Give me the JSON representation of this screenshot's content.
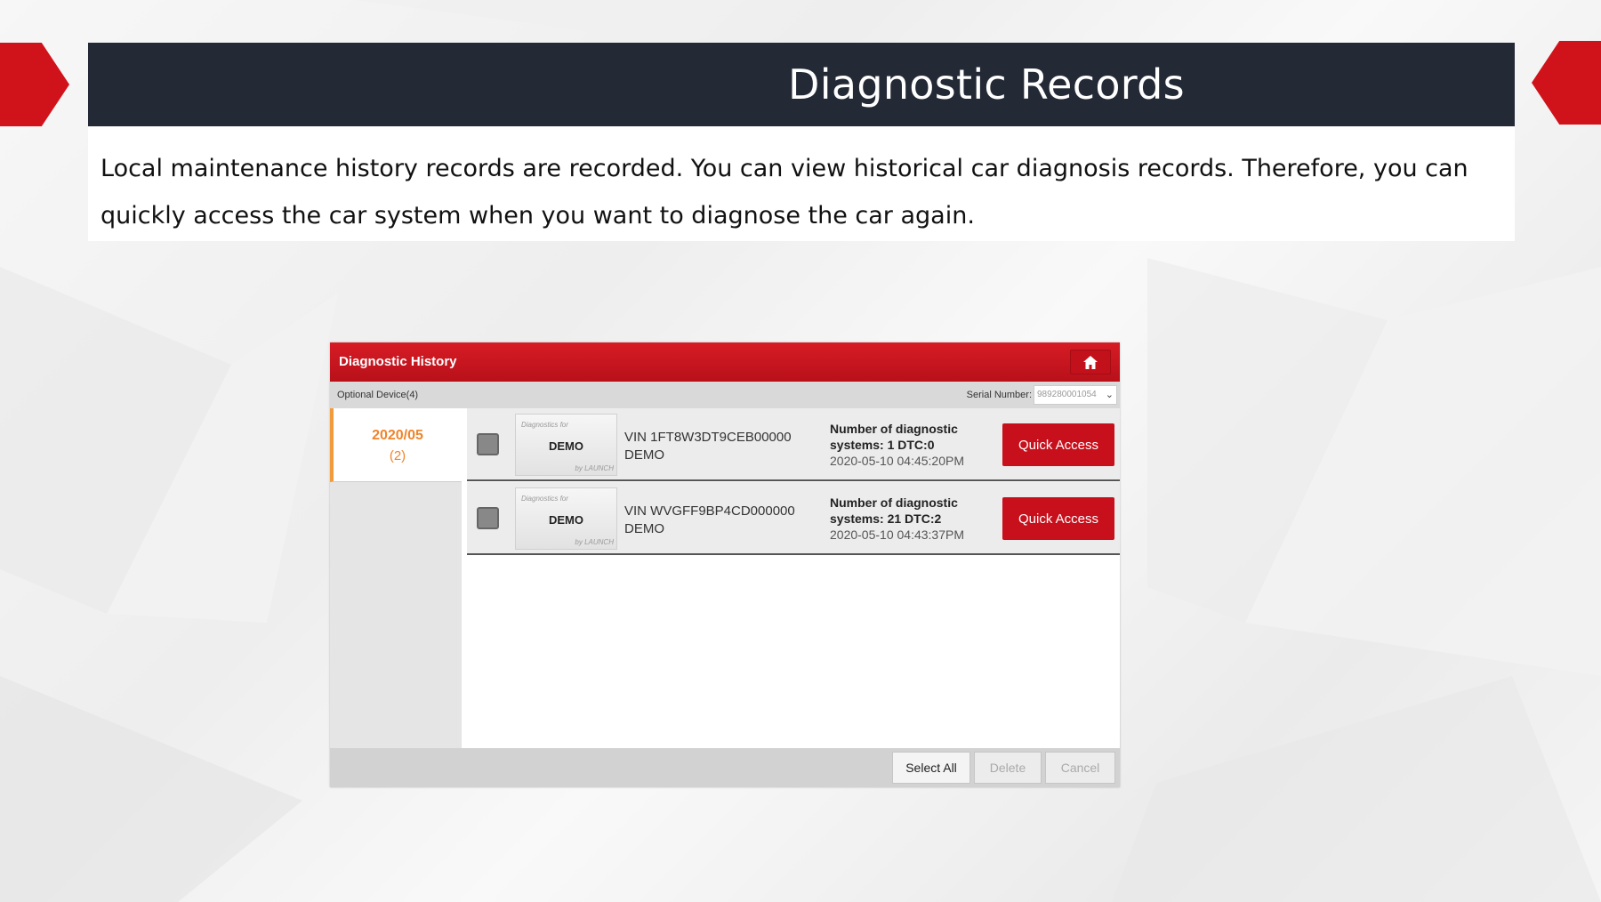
{
  "slide": {
    "title": "Diagnostic Records",
    "description": "Local maintenance history records are recorded. You can view historical car diagnosis records. Therefore, you can quickly access the car system when you want to diagnose the car again.",
    "accent_color": "#d0121b",
    "title_bar_color": "#232a36"
  },
  "app": {
    "header_title": "Diagnostic History",
    "home_icon": "home-icon",
    "optional_device_label": "Optional Device(4)",
    "serial_label": "Serial Number:",
    "serial_value": "989280001054",
    "date_group": {
      "date": "2020/05",
      "count": "(2)"
    },
    "records": [
      {
        "thumb_top": "Diagnostics for",
        "thumb_main": "DEMO",
        "thumb_bottom": "by LAUNCH",
        "vin": "VIN 1FT8W3DT9CEB00000",
        "model": "DEMO",
        "info_line1": "Number of diagnostic",
        "info_line2": "systems: 1 DTC:0",
        "timestamp": "2020-05-10 04:45:20PM",
        "button": "Quick Access"
      },
      {
        "thumb_top": "Diagnostics for",
        "thumb_main": "DEMO",
        "thumb_bottom": "by LAUNCH",
        "vin": "VIN WVGFF9BP4CD000000",
        "model": "DEMO",
        "info_line1": "Number of diagnostic",
        "info_line2": "systems: 21 DTC:2",
        "timestamp": "2020-05-10 04:43:37PM",
        "button": "Quick Access"
      }
    ],
    "footer": {
      "select_all": "Select All",
      "delete": "Delete",
      "cancel": "Cancel"
    }
  }
}
